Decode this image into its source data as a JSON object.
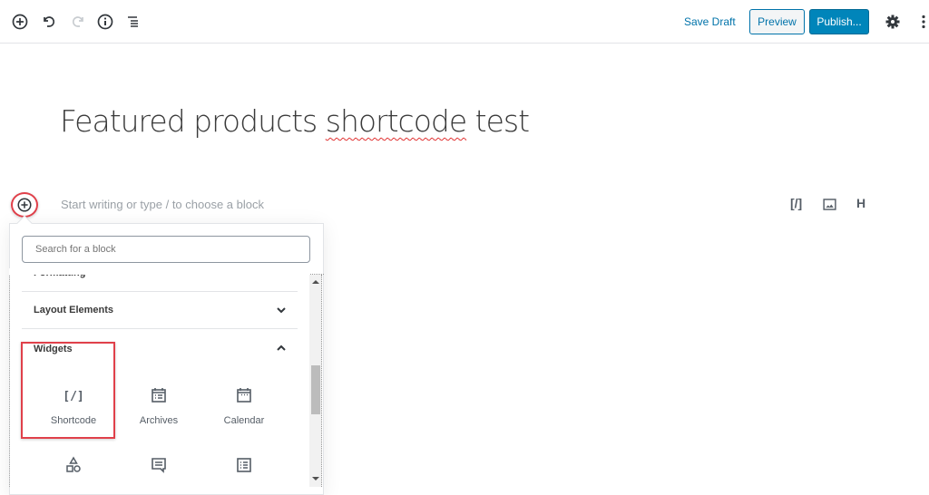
{
  "toolbar": {
    "icons": [
      "add-block-icon",
      "undo-icon",
      "redo-icon",
      "info-icon",
      "block-navigation-icon"
    ],
    "save_draft": "Save Draft",
    "preview": "Preview",
    "publish": "Publish...",
    "settings_icon": "gear-icon",
    "more_icon": "more-vertical-icon"
  },
  "editor": {
    "title_part1": "Featured products ",
    "title_misspelled": "shortcode",
    "title_part2": " test",
    "placeholder": "Start writing or type / to choose a block",
    "shortcuts": [
      "[/]",
      "image-icon",
      "H"
    ]
  },
  "inserter": {
    "search_placeholder": "Search for a block",
    "sections": [
      {
        "label": "Formatting",
        "expanded": false
      },
      {
        "label": "Layout Elements",
        "expanded": false
      },
      {
        "label": "Widgets",
        "expanded": true
      }
    ],
    "widgets": [
      {
        "label": "Shortcode",
        "icon": "shortcode-icon"
      },
      {
        "label": "Archives",
        "icon": "archives-icon"
      },
      {
        "label": "Calendar",
        "icon": "calendar-icon"
      },
      {
        "label": "",
        "icon": "shapes-icon"
      },
      {
        "label": "",
        "icon": "comments-icon"
      },
      {
        "label": "",
        "icon": "list-icon"
      }
    ]
  },
  "colors": {
    "accent": "#0073aa",
    "publish": "#0085ba",
    "highlight": "#e0404a"
  }
}
